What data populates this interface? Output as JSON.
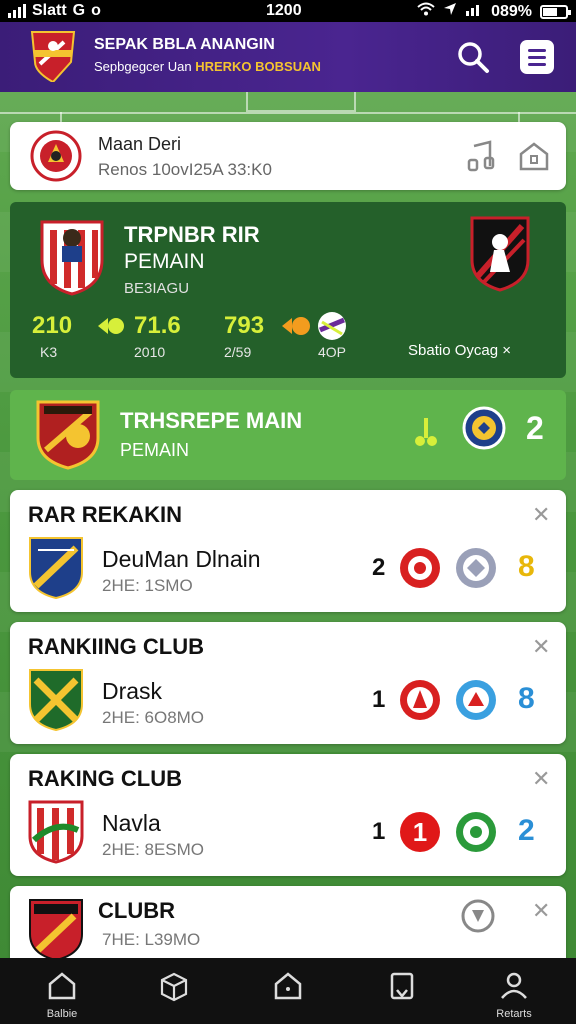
{
  "status_bar": {
    "carrier": "Slatt",
    "app_badge": "G",
    "dot": "o",
    "time": "1200",
    "battery": "089%"
  },
  "header": {
    "title": "SEPAK BBLA ANANGIN",
    "subtitle_prefix": "Sepbgegcer Uan",
    "subtitle_highlight": "HRERKO BOBSUAN"
  },
  "match_card": {
    "name": "Maan Deri",
    "info": "Renos 10ovI25A 33:K0"
  },
  "feature": {
    "title": "TRPNBR RIR",
    "subtitle": "PEMAIN",
    "caption": "BE3IAGU",
    "stats": [
      {
        "value": "210",
        "label": "K3"
      },
      {
        "value": "71.6",
        "label": "2010"
      },
      {
        "value": "793",
        "label": "2/59"
      },
      {
        "value": "",
        "label": "4OP"
      }
    ],
    "footer": "Sbatio Oycag ×"
  },
  "banner": {
    "title": "TRHSREPE MAIN",
    "subtitle": "PEMAIN",
    "count": "2"
  },
  "rankings": [
    {
      "heading": "RAR REKAKIN",
      "club": "DeuMan Dlnain",
      "info": "2HE: 1SMO",
      "score": "2",
      "points": "8",
      "points_color": "#e8b70a"
    },
    {
      "heading": "RANKIING CLUB",
      "club": "Drask",
      "info": "2HE: 6O8MO",
      "score": "1",
      "points": "8",
      "points_color": "#2a8fd6"
    },
    {
      "heading": "RAKING CLUB",
      "club": "Navla",
      "info": "2HE: 8ESMO",
      "score": "1",
      "points": "2",
      "points_color": "#2a8fd6"
    },
    {
      "heading": "CLUBR",
      "club": "",
      "info": "7HE: L39MO",
      "score": "",
      "points": "",
      "points_color": "#2a8fd6"
    }
  ],
  "bottom_nav": [
    {
      "label": "Balbie",
      "icon": "home-icon"
    },
    {
      "label": "",
      "icon": "cube-icon"
    },
    {
      "label": "",
      "icon": "house-alt-icon"
    },
    {
      "label": "",
      "icon": "clipboard-icon"
    },
    {
      "label": "Retarts",
      "icon": "person-icon"
    }
  ],
  "colors": {
    "header": "#4a2590",
    "feature": "#24602a",
    "banner": "#5fb44c",
    "stat_yellow": "#d7ef3a"
  }
}
